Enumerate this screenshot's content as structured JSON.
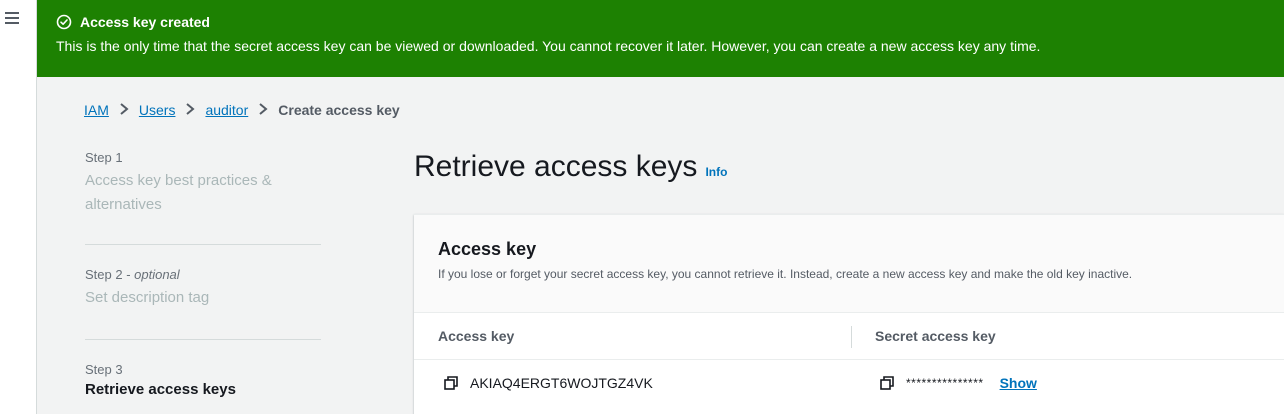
{
  "nav": {
    "menu_icon": "hamburger-menu-icon"
  },
  "flash": {
    "icon": "check-circle-icon",
    "title": "Access key created",
    "message": "This is the only time that the secret access key can be viewed or downloaded. You cannot recover it later. However, you can create a new access key any time.",
    "color": "#1d8102"
  },
  "breadcrumb": {
    "items": [
      "IAM",
      "Users",
      "auditor"
    ],
    "current": "Create access key",
    "separator_icon": "chevron-right-icon"
  },
  "steps": [
    {
      "label": "Step 1",
      "title": "Access key best practices & alternatives",
      "state": "disabled"
    },
    {
      "label": "Step 2 - ",
      "label_suffix": "optional",
      "title": "Set description tag",
      "state": "disabled"
    },
    {
      "label": "Step 3",
      "title": "Retrieve access keys",
      "state": "active"
    }
  ],
  "main": {
    "title": "Retrieve access keys",
    "info_link": "Info"
  },
  "card": {
    "title": "Access key",
    "description": "If you lose or forget your secret access key, you cannot retrieve it. Instead, create a new access key and make the old key inactive.",
    "columns": [
      "Access key",
      "Secret access key"
    ],
    "access_key_value": "AKIAQ4ERGT6WOJTGZ4VK",
    "secret_masked": "***************",
    "show_label": "Show",
    "copy_icon": "copy-icon"
  },
  "colors": {
    "link": "#0073bb",
    "success": "#1d8102",
    "background": "#f2f3f3"
  }
}
